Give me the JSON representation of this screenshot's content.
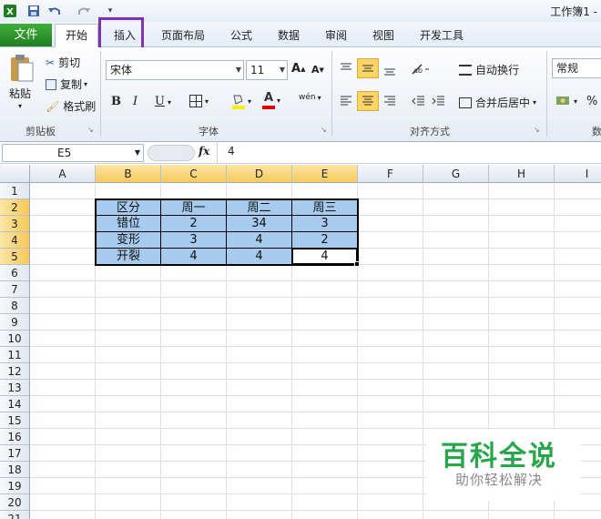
{
  "app": {
    "title": "工作簿1 -"
  },
  "tabs": {
    "file": "文件",
    "home": "开始",
    "insert": "插入",
    "page_layout": "页面布局",
    "formulas": "公式",
    "data": "数据",
    "review": "审阅",
    "view": "视图",
    "developer": "开发工具"
  },
  "ribbon": {
    "clipboard": {
      "paste": "粘贴",
      "cut": "剪切",
      "copy": "复制",
      "format_painter": "格式刷",
      "label": "剪贴板"
    },
    "font": {
      "name": "宋体",
      "size": "11",
      "bold": "B",
      "italic": "I",
      "underline": "U",
      "phonetic": "wén",
      "label": "字体"
    },
    "alignment": {
      "wrap_text": "自动换行",
      "merge_center": "合并后居中",
      "label": "对齐方式"
    },
    "number": {
      "format": "常规",
      "percent": "%",
      "label": "数"
    }
  },
  "formula_bar": {
    "name_box": "E5",
    "fx": "fx",
    "value": "4"
  },
  "sheet": {
    "columns": [
      "A",
      "B",
      "C",
      "D",
      "E",
      "F",
      "G",
      "H",
      "I"
    ],
    "rows": [
      "1",
      "2",
      "3",
      "4",
      "5",
      "6",
      "7",
      "8",
      "9",
      "10",
      "11",
      "12",
      "13",
      "14",
      "15",
      "16",
      "17",
      "18",
      "19",
      "20",
      "21"
    ],
    "table": [
      [
        "区分",
        "周一",
        "周二",
        "周三"
      ],
      [
        "错位",
        "2",
        "34",
        "3"
      ],
      [
        "变形",
        "3",
        "4",
        "2"
      ],
      [
        "开裂",
        "4",
        "4",
        "4"
      ]
    ],
    "selected_cell": "E5"
  },
  "watermark": {
    "title": "百科全说",
    "subtitle": "助你轻松解决"
  },
  "colors": {
    "file_tab": "#2a8f2c",
    "highlight_border": "#7b35b0",
    "table_fill": "#a7cbee",
    "selection_header": "#f7c95a",
    "watermark_green": "#27a64a"
  }
}
